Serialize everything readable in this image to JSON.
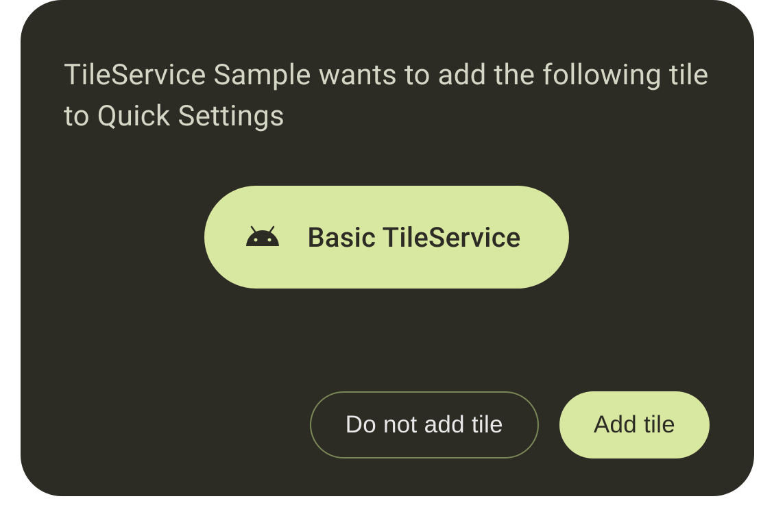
{
  "dialog": {
    "title": "TileService Sample wants to add the following tile to Quick Settings",
    "tile": {
      "icon_name": "android-icon",
      "label": "Basic TileService"
    },
    "buttons": {
      "decline": "Do not add tile",
      "accept": "Add tile"
    }
  },
  "colors": {
    "dialog_bg": "#2c2c25",
    "accent": "#d9e8a1",
    "text_light": "#d4d6c6",
    "outline": "#7a8756"
  }
}
